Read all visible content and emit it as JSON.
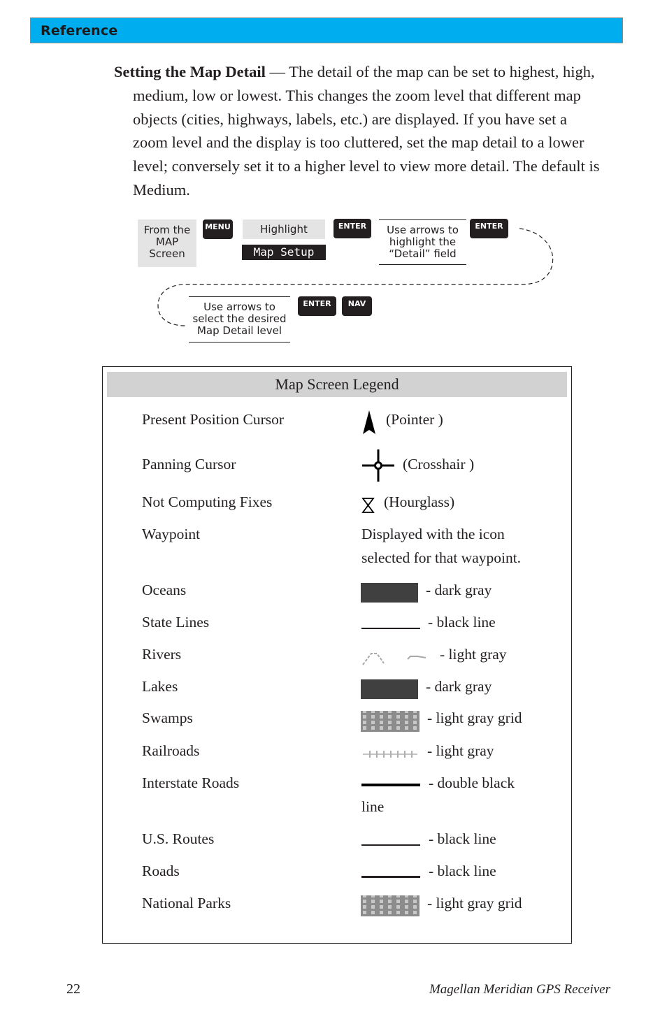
{
  "header": {
    "section_title": "Reference",
    "bar_color": "#00adee"
  },
  "intro": {
    "lead": "Setting the Map Detail",
    "text": " — The detail of the map can be set to highest, high, medium, low or lowest. This changes the zoom level that different map objects (cities, highways, labels, etc.) are displayed.  If you have set a zoom level and the display is too cluttered, set the map detail to a lower level; conversely set it to a higher level to view more detail.  The default is Medium."
  },
  "flow": {
    "start_box": "From the MAP Screen",
    "key_menu": "MENU",
    "highlight_label": "Highlight",
    "highlight_item": "Map Setup",
    "key_enter_1": "ENTER",
    "step_detail_field": "Use arrows to highlight the “Detail” field",
    "key_enter_2": "ENTER",
    "step_select_level": "Use arrows to select the desired Map Detail level",
    "key_enter_3": "ENTER",
    "key_nav": "NAV"
  },
  "legend": {
    "title": "Map Screen Legend",
    "rows": [
      {
        "label": "Present Position Cursor",
        "icon": "pointer-icon",
        "desc": "(Pointer )"
      },
      {
        "label": "Panning Cursor",
        "icon": "crosshair-icon",
        "desc": "(Crosshair )"
      },
      {
        "label": "Not Computing Fixes",
        "icon": "hourglass-icon",
        "desc": "(Hourglass)"
      },
      {
        "label": "Waypoint",
        "icon": "",
        "desc": "Displayed with the icon",
        "desc2": "selected for that waypoint."
      },
      {
        "label": "Oceans",
        "icon": "dark-gray-swatch",
        "desc": "- dark gray"
      },
      {
        "label": "State Lines",
        "icon": "black-line-swatch",
        "desc": "- black line"
      },
      {
        "label": "Rivers",
        "icon": "river-line-swatch",
        "desc": "- light gray"
      },
      {
        "label": "Lakes",
        "icon": "dark-gray-swatch",
        "desc": "- dark gray"
      },
      {
        "label": "Swamps",
        "icon": "gray-grid-swatch",
        "desc": "- light gray grid"
      },
      {
        "label": "Railroads",
        "icon": "railroad-swatch",
        "desc": "- light gray"
      },
      {
        "label": "Interstate Roads",
        "icon": "double-black-line-swatch",
        "desc": "- double black",
        "desc2": "line"
      },
      {
        "label": "U.S. Routes",
        "icon": "black-line-swatch",
        "desc": "- black line"
      },
      {
        "label": "Roads",
        "icon": "black-line-swatch",
        "desc": "- black line"
      },
      {
        "label": "National Parks",
        "icon": "gray-grid-swatch",
        "desc": "- light gray grid"
      }
    ]
  },
  "footer": {
    "page_number": "22",
    "book_title": "Magellan Meridian GPS Receiver"
  }
}
